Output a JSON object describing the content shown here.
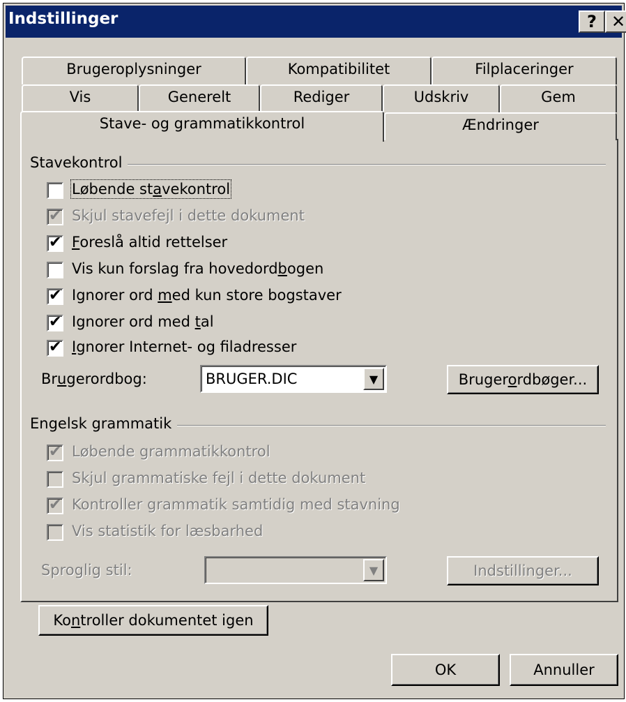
{
  "window": {
    "title": "Indstillinger",
    "help_button": "?",
    "close_button": "✕"
  },
  "tabs": {
    "row1": [
      "Brugeroplysninger",
      "Kompatibilitet",
      "Filplaceringer"
    ],
    "row2": [
      "Vis",
      "Generelt",
      "Rediger",
      "Udskriv",
      "Gem"
    ],
    "row3": [
      "Stave- og grammatikkontrol",
      "Ændringer"
    ],
    "active": "Stave- og grammatikkontrol"
  },
  "spelling": {
    "group_label": "Stavekontrol",
    "options": [
      {
        "pre": "Løbende st",
        "ul": "a",
        "post": "vekontrol",
        "checked": false,
        "enabled": true,
        "focused": true
      },
      {
        "pre": "Skjul stavefejl i dette dokument",
        "ul": "",
        "post": "",
        "checked": true,
        "enabled": false
      },
      {
        "pre": "",
        "ul": "F",
        "post": "oreslå altid rettelser",
        "checked": true,
        "enabled": true
      },
      {
        "pre": "Vis kun forslag fra hovedord",
        "ul": "b",
        "post": "ogen",
        "checked": false,
        "enabled": true
      },
      {
        "pre": "Ignorer ord ",
        "ul": "m",
        "post": "ed kun store bogstaver",
        "checked": true,
        "enabled": true
      },
      {
        "pre": "Ignorer ord med ",
        "ul": "t",
        "post": "al",
        "checked": true,
        "enabled": true
      },
      {
        "pre": "",
        "ul": "I",
        "post": "gnorer Internet- og filadresser",
        "checked": true,
        "enabled": true
      }
    ],
    "dictionary_label": {
      "pre": "Br",
      "ul": "u",
      "post": "gerordbog:"
    },
    "dictionary_value": "BRUGER.DIC",
    "dictionaries_button": {
      "pre": "Bruger",
      "ul": "o",
      "post": "rdbøger..."
    }
  },
  "grammar": {
    "group_label": "Engelsk grammatik",
    "options": [
      {
        "label": "Løbende grammatikkontrol",
        "checked": true,
        "enabled": false
      },
      {
        "label": "Skjul grammatiske fejl i dette dokument",
        "checked": false,
        "enabled": false
      },
      {
        "label": "Kontroller grammatik samtidig med stavning",
        "checked": true,
        "enabled": false
      },
      {
        "label": "Vis statistik for læsbarhed",
        "checked": false,
        "enabled": false
      }
    ],
    "style_label": "Sproglig stil:",
    "style_value": "",
    "settings_button": "Indstillinger..."
  },
  "recheck_button": {
    "pre": "Ko",
    "ul": "n",
    "post": "troller dokumentet igen"
  },
  "footer": {
    "ok": "OK",
    "cancel": "Annuller"
  }
}
